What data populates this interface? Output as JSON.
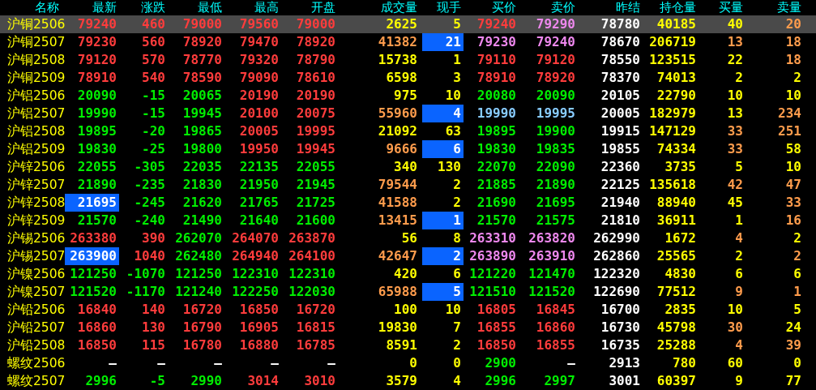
{
  "columns": [
    "名称",
    "最新",
    "涨跌",
    "最低",
    "最高",
    "开盘",
    "成交量",
    "现手",
    "买价",
    "卖价",
    "昨结",
    "持仓量",
    "买量",
    "卖量"
  ],
  "rows": [
    {
      "name": "沪铜2506",
      "selected": true,
      "cells": [
        {
          "text": "79240",
          "color": "#ff3c3c"
        },
        {
          "text": "460",
          "color": "#ff3c3c"
        },
        {
          "text": "79000",
          "color": "#ff3c3c"
        },
        {
          "text": "79560",
          "color": "#ff3c3c"
        },
        {
          "text": "79000",
          "color": "#ff3c3c"
        },
        {
          "text": "2625",
          "color": "#ffff00"
        },
        {
          "text": "5",
          "color": "#ffff00"
        },
        {
          "text": "79240",
          "color": "#ff3c3c"
        },
        {
          "text": "79290",
          "color": "#ee88ee"
        },
        {
          "text": "78780",
          "color": "#ffffff"
        },
        {
          "text": "40185",
          "color": "#ffff00"
        },
        {
          "text": "40",
          "color": "#ffff00"
        },
        {
          "text": "20",
          "color": "#ff9c4c"
        }
      ]
    },
    {
      "name": "沪铜2507",
      "selected": false,
      "cells": [
        {
          "text": "79230",
          "color": "#ff3c3c"
        },
        {
          "text": "560",
          "color": "#ff3c3c"
        },
        {
          "text": "78920",
          "color": "#ff3c3c"
        },
        {
          "text": "79470",
          "color": "#ff3c3c"
        },
        {
          "text": "78920",
          "color": "#ff3c3c"
        },
        {
          "text": "41382",
          "color": "#ff9c4c"
        },
        {
          "text": "21",
          "color": "#ffffff",
          "highlighted": true
        },
        {
          "text": "79230",
          "color": "#ee88ee"
        },
        {
          "text": "79240",
          "color": "#ee88ee"
        },
        {
          "text": "78670",
          "color": "#ffffff"
        },
        {
          "text": "206719",
          "color": "#ffff00"
        },
        {
          "text": "13",
          "color": "#ff9c4c"
        },
        {
          "text": "18",
          "color": "#ff9c4c"
        }
      ]
    },
    {
      "name": "沪铜2508",
      "selected": false,
      "cells": [
        {
          "text": "79120",
          "color": "#ff3c3c"
        },
        {
          "text": "570",
          "color": "#ff3c3c"
        },
        {
          "text": "78770",
          "color": "#ff3c3c"
        },
        {
          "text": "79320",
          "color": "#ff3c3c"
        },
        {
          "text": "78790",
          "color": "#ff3c3c"
        },
        {
          "text": "15738",
          "color": "#ffff00"
        },
        {
          "text": "1",
          "color": "#ffff00"
        },
        {
          "text": "79110",
          "color": "#ff3c3c"
        },
        {
          "text": "79120",
          "color": "#ff3c3c"
        },
        {
          "text": "78550",
          "color": "#ffffff"
        },
        {
          "text": "123515",
          "color": "#ffff00"
        },
        {
          "text": "22",
          "color": "#ffff00"
        },
        {
          "text": "18",
          "color": "#ff9c4c"
        }
      ]
    },
    {
      "name": "沪铜2509",
      "selected": false,
      "cells": [
        {
          "text": "78910",
          "color": "#ff3c3c"
        },
        {
          "text": "540",
          "color": "#ff3c3c"
        },
        {
          "text": "78590",
          "color": "#ff3c3c"
        },
        {
          "text": "79090",
          "color": "#ff3c3c"
        },
        {
          "text": "78610",
          "color": "#ff3c3c"
        },
        {
          "text": "6598",
          "color": "#ffff00"
        },
        {
          "text": "3",
          "color": "#ffff00"
        },
        {
          "text": "78910",
          "color": "#ff3c3c"
        },
        {
          "text": "78920",
          "color": "#ff3c3c"
        },
        {
          "text": "78370",
          "color": "#ffffff"
        },
        {
          "text": "74013",
          "color": "#ffff00"
        },
        {
          "text": "2",
          "color": "#ffff00"
        },
        {
          "text": "2",
          "color": "#ffff00"
        }
      ]
    },
    {
      "name": "沪铝2506",
      "selected": false,
      "cells": [
        {
          "text": "20090",
          "color": "#00ee00"
        },
        {
          "text": "-15",
          "color": "#00ee00"
        },
        {
          "text": "20065",
          "color": "#00ee00"
        },
        {
          "text": "20190",
          "color": "#ff3c3c"
        },
        {
          "text": "20190",
          "color": "#ff3c3c"
        },
        {
          "text": "975",
          "color": "#ffff00"
        },
        {
          "text": "10",
          "color": "#ffff00"
        },
        {
          "text": "20080",
          "color": "#00ee00"
        },
        {
          "text": "20090",
          "color": "#00ee00"
        },
        {
          "text": "20105",
          "color": "#ffffff"
        },
        {
          "text": "22790",
          "color": "#ffff00"
        },
        {
          "text": "10",
          "color": "#ffff00"
        },
        {
          "text": "10",
          "color": "#ffff00"
        }
      ]
    },
    {
      "name": "沪铝2507",
      "selected": false,
      "cells": [
        {
          "text": "19990",
          "color": "#00ee00"
        },
        {
          "text": "-15",
          "color": "#00ee00"
        },
        {
          "text": "19945",
          "color": "#00ee00"
        },
        {
          "text": "20100",
          "color": "#ff3c3c"
        },
        {
          "text": "20075",
          "color": "#ff3c3c"
        },
        {
          "text": "55960",
          "color": "#ff9c4c"
        },
        {
          "text": "4",
          "color": "#ffffff",
          "highlighted": true
        },
        {
          "text": "19990",
          "color": "#88ccff"
        },
        {
          "text": "19995",
          "color": "#88ccff"
        },
        {
          "text": "20005",
          "color": "#ffffff"
        },
        {
          "text": "182979",
          "color": "#ffff00"
        },
        {
          "text": "13",
          "color": "#ffff00"
        },
        {
          "text": "234",
          "color": "#ff9c4c"
        }
      ]
    },
    {
      "name": "沪铝2508",
      "selected": false,
      "cells": [
        {
          "text": "19895",
          "color": "#00ee00"
        },
        {
          "text": "-20",
          "color": "#00ee00"
        },
        {
          "text": "19865",
          "color": "#00ee00"
        },
        {
          "text": "20005",
          "color": "#ff3c3c"
        },
        {
          "text": "19995",
          "color": "#ff3c3c"
        },
        {
          "text": "21092",
          "color": "#ffff00"
        },
        {
          "text": "63",
          "color": "#ffff00"
        },
        {
          "text": "19895",
          "color": "#00ee00"
        },
        {
          "text": "19900",
          "color": "#00ee00"
        },
        {
          "text": "19915",
          "color": "#ffffff"
        },
        {
          "text": "147129",
          "color": "#ffff00"
        },
        {
          "text": "33",
          "color": "#ff9c4c"
        },
        {
          "text": "251",
          "color": "#ff9c4c"
        }
      ]
    },
    {
      "name": "沪铝2509",
      "selected": false,
      "cells": [
        {
          "text": "19830",
          "color": "#00ee00"
        },
        {
          "text": "-25",
          "color": "#00ee00"
        },
        {
          "text": "19800",
          "color": "#00ee00"
        },
        {
          "text": "19950",
          "color": "#ff3c3c"
        },
        {
          "text": "19945",
          "color": "#ff3c3c"
        },
        {
          "text": "9666",
          "color": "#ff9c4c"
        },
        {
          "text": "6",
          "color": "#ffffff",
          "highlighted": true
        },
        {
          "text": "19830",
          "color": "#00ee00"
        },
        {
          "text": "19835",
          "color": "#00ee00"
        },
        {
          "text": "19855",
          "color": "#ffffff"
        },
        {
          "text": "74334",
          "color": "#ffff00"
        },
        {
          "text": "33",
          "color": "#ff9c4c"
        },
        {
          "text": "58",
          "color": "#ffff00"
        }
      ]
    },
    {
      "name": "沪锌2506",
      "selected": false,
      "cells": [
        {
          "text": "22055",
          "color": "#00ee00"
        },
        {
          "text": "-305",
          "color": "#00ee00"
        },
        {
          "text": "22035",
          "color": "#00ee00"
        },
        {
          "text": "22135",
          "color": "#00ee00"
        },
        {
          "text": "22055",
          "color": "#00ee00"
        },
        {
          "text": "340",
          "color": "#ffff00"
        },
        {
          "text": "130",
          "color": "#ffff00"
        },
        {
          "text": "22070",
          "color": "#00ee00"
        },
        {
          "text": "22090",
          "color": "#00ee00"
        },
        {
          "text": "22360",
          "color": "#ffffff"
        },
        {
          "text": "3735",
          "color": "#ffff00"
        },
        {
          "text": "5",
          "color": "#ffff00"
        },
        {
          "text": "10",
          "color": "#ffff00"
        }
      ]
    },
    {
      "name": "沪锌2507",
      "selected": false,
      "cells": [
        {
          "text": "21890",
          "color": "#00ee00"
        },
        {
          "text": "-235",
          "color": "#00ee00"
        },
        {
          "text": "21830",
          "color": "#00ee00"
        },
        {
          "text": "21950",
          "color": "#00ee00"
        },
        {
          "text": "21945",
          "color": "#00ee00"
        },
        {
          "text": "79544",
          "color": "#ff9c4c"
        },
        {
          "text": "2",
          "color": "#ffff00"
        },
        {
          "text": "21885",
          "color": "#00ee00"
        },
        {
          "text": "21890",
          "color": "#00ee00"
        },
        {
          "text": "22125",
          "color": "#ffffff"
        },
        {
          "text": "135618",
          "color": "#ffff00"
        },
        {
          "text": "42",
          "color": "#ff9c4c"
        },
        {
          "text": "47",
          "color": "#ff9c4c"
        }
      ]
    },
    {
      "name": "沪锌2508",
      "selected": false,
      "cells": [
        {
          "text": "21695",
          "color": "#ffffff",
          "highlighted": true
        },
        {
          "text": "-245",
          "color": "#00ee00"
        },
        {
          "text": "21620",
          "color": "#00ee00"
        },
        {
          "text": "21765",
          "color": "#00ee00"
        },
        {
          "text": "21725",
          "color": "#00ee00"
        },
        {
          "text": "41588",
          "color": "#ff9c4c"
        },
        {
          "text": "2",
          "color": "#ffff00"
        },
        {
          "text": "21690",
          "color": "#00ee00"
        },
        {
          "text": "21695",
          "color": "#00ee00"
        },
        {
          "text": "21940",
          "color": "#ffffff"
        },
        {
          "text": "88940",
          "color": "#ffff00"
        },
        {
          "text": "45",
          "color": "#ffff00"
        },
        {
          "text": "33",
          "color": "#ff9c4c"
        }
      ]
    },
    {
      "name": "沪锌2509",
      "selected": false,
      "cells": [
        {
          "text": "21570",
          "color": "#00ee00"
        },
        {
          "text": "-240",
          "color": "#00ee00"
        },
        {
          "text": "21490",
          "color": "#00ee00"
        },
        {
          "text": "21640",
          "color": "#00ee00"
        },
        {
          "text": "21600",
          "color": "#00ee00"
        },
        {
          "text": "13415",
          "color": "#ff9c4c"
        },
        {
          "text": "1",
          "color": "#ffffff",
          "highlighted": true
        },
        {
          "text": "21570",
          "color": "#00ee00"
        },
        {
          "text": "21575",
          "color": "#00ee00"
        },
        {
          "text": "21810",
          "color": "#ffffff"
        },
        {
          "text": "36911",
          "color": "#ffff00"
        },
        {
          "text": "1",
          "color": "#ffff00"
        },
        {
          "text": "16",
          "color": "#ff9c4c"
        }
      ]
    },
    {
      "name": "沪锡2506",
      "selected": false,
      "cells": [
        {
          "text": "263380",
          "color": "#ff3c3c"
        },
        {
          "text": "390",
          "color": "#ff3c3c"
        },
        {
          "text": "262070",
          "color": "#00ee00"
        },
        {
          "text": "264070",
          "color": "#ff3c3c"
        },
        {
          "text": "263870",
          "color": "#ff3c3c"
        },
        {
          "text": "56",
          "color": "#ffff00"
        },
        {
          "text": "8",
          "color": "#ffff00"
        },
        {
          "text": "263310",
          "color": "#ee88ee"
        },
        {
          "text": "263820",
          "color": "#ee88ee"
        },
        {
          "text": "262990",
          "color": "#ffffff"
        },
        {
          "text": "1672",
          "color": "#ffff00"
        },
        {
          "text": "4",
          "color": "#ff9c4c"
        },
        {
          "text": "2",
          "color": "#ffff00"
        }
      ]
    },
    {
      "name": "沪锡2507",
      "selected": false,
      "cells": [
        {
          "text": "263900",
          "color": "#ffffff",
          "highlighted": true
        },
        {
          "text": "1040",
          "color": "#ff3c3c"
        },
        {
          "text": "262480",
          "color": "#00ee00"
        },
        {
          "text": "264940",
          "color": "#ff3c3c"
        },
        {
          "text": "264100",
          "color": "#ff3c3c"
        },
        {
          "text": "42647",
          "color": "#ff9c4c"
        },
        {
          "text": "2",
          "color": "#ffffff",
          "highlighted": true
        },
        {
          "text": "263890",
          "color": "#ee88ee"
        },
        {
          "text": "263910",
          "color": "#ee88ee"
        },
        {
          "text": "262860",
          "color": "#ffffff"
        },
        {
          "text": "25565",
          "color": "#ffff00"
        },
        {
          "text": "2",
          "color": "#ffff00"
        },
        {
          "text": "2",
          "color": "#ff9c4c"
        }
      ]
    },
    {
      "name": "沪镍2506",
      "selected": false,
      "cells": [
        {
          "text": "121250",
          "color": "#00ee00"
        },
        {
          "text": "-1070",
          "color": "#00ee00"
        },
        {
          "text": "121250",
          "color": "#00ee00"
        },
        {
          "text": "122310",
          "color": "#00ee00"
        },
        {
          "text": "122310",
          "color": "#00ee00"
        },
        {
          "text": "420",
          "color": "#ffff00"
        },
        {
          "text": "6",
          "color": "#ffff00"
        },
        {
          "text": "121220",
          "color": "#00ee00"
        },
        {
          "text": "121470",
          "color": "#00ee00"
        },
        {
          "text": "122320",
          "color": "#ffffff"
        },
        {
          "text": "4830",
          "color": "#ffff00"
        },
        {
          "text": "6",
          "color": "#ffff00"
        },
        {
          "text": "6",
          "color": "#ffff00"
        }
      ]
    },
    {
      "name": "沪镍2507",
      "selected": false,
      "cells": [
        {
          "text": "121520",
          "color": "#00ee00"
        },
        {
          "text": "-1170",
          "color": "#00ee00"
        },
        {
          "text": "121240",
          "color": "#00ee00"
        },
        {
          "text": "122250",
          "color": "#00ee00"
        },
        {
          "text": "122030",
          "color": "#00ee00"
        },
        {
          "text": "65988",
          "color": "#ff9c4c"
        },
        {
          "text": "5",
          "color": "#ffffff",
          "highlighted": true
        },
        {
          "text": "121510",
          "color": "#00ee00"
        },
        {
          "text": "121520",
          "color": "#00ee00"
        },
        {
          "text": "122690",
          "color": "#ffffff"
        },
        {
          "text": "77512",
          "color": "#ffff00"
        },
        {
          "text": "9",
          "color": "#ff9c4c"
        },
        {
          "text": "1",
          "color": "#ff9c4c"
        }
      ]
    },
    {
      "name": "沪铅2506",
      "selected": false,
      "cells": [
        {
          "text": "16840",
          "color": "#ff3c3c"
        },
        {
          "text": "140",
          "color": "#ff3c3c"
        },
        {
          "text": "16720",
          "color": "#ff3c3c"
        },
        {
          "text": "16850",
          "color": "#ff3c3c"
        },
        {
          "text": "16720",
          "color": "#ff3c3c"
        },
        {
          "text": "100",
          "color": "#ffff00"
        },
        {
          "text": "10",
          "color": "#ffff00"
        },
        {
          "text": "16805",
          "color": "#ff3c3c"
        },
        {
          "text": "16845",
          "color": "#ff3c3c"
        },
        {
          "text": "16700",
          "color": "#ffffff"
        },
        {
          "text": "2835",
          "color": "#ffff00"
        },
        {
          "text": "10",
          "color": "#ffff00"
        },
        {
          "text": "5",
          "color": "#ffff00"
        }
      ]
    },
    {
      "name": "沪铅2507",
      "selected": false,
      "cells": [
        {
          "text": "16860",
          "color": "#ff3c3c"
        },
        {
          "text": "130",
          "color": "#ff3c3c"
        },
        {
          "text": "16790",
          "color": "#ff3c3c"
        },
        {
          "text": "16905",
          "color": "#ff3c3c"
        },
        {
          "text": "16815",
          "color": "#ff3c3c"
        },
        {
          "text": "19830",
          "color": "#ffff00"
        },
        {
          "text": "7",
          "color": "#ffff00"
        },
        {
          "text": "16855",
          "color": "#ff3c3c"
        },
        {
          "text": "16860",
          "color": "#ff3c3c"
        },
        {
          "text": "16730",
          "color": "#ffffff"
        },
        {
          "text": "45798",
          "color": "#ffff00"
        },
        {
          "text": "30",
          "color": "#ff9c4c"
        },
        {
          "text": "24",
          "color": "#ffff00"
        }
      ]
    },
    {
      "name": "沪铅2508",
      "selected": false,
      "cells": [
        {
          "text": "16850",
          "color": "#ff3c3c"
        },
        {
          "text": "115",
          "color": "#ff3c3c"
        },
        {
          "text": "16780",
          "color": "#ff3c3c"
        },
        {
          "text": "16880",
          "color": "#ff3c3c"
        },
        {
          "text": "16785",
          "color": "#ff3c3c"
        },
        {
          "text": "8591",
          "color": "#ffff00"
        },
        {
          "text": "2",
          "color": "#ffff00"
        },
        {
          "text": "16850",
          "color": "#ff3c3c"
        },
        {
          "text": "16855",
          "color": "#ff3c3c"
        },
        {
          "text": "16735",
          "color": "#ffffff"
        },
        {
          "text": "25288",
          "color": "#ffff00"
        },
        {
          "text": "4",
          "color": "#ff9c4c"
        },
        {
          "text": "39",
          "color": "#ff9c4c"
        }
      ]
    },
    {
      "name": "螺纹2506",
      "selected": false,
      "cells": [
        {
          "text": "—",
          "color": "#ffffff"
        },
        {
          "text": "—",
          "color": "#ffffff"
        },
        {
          "text": "—",
          "color": "#ffffff"
        },
        {
          "text": "—",
          "color": "#ffffff"
        },
        {
          "text": "—",
          "color": "#ffffff"
        },
        {
          "text": "0",
          "color": "#ffff00"
        },
        {
          "text": "0",
          "color": "#ffff00"
        },
        {
          "text": "2900",
          "color": "#00ee00"
        },
        {
          "text": "—",
          "color": "#ffffff"
        },
        {
          "text": "2913",
          "color": "#ffffff"
        },
        {
          "text": "780",
          "color": "#ffff00"
        },
        {
          "text": "60",
          "color": "#ffff00"
        },
        {
          "text": "0",
          "color": "#ffff00"
        }
      ]
    },
    {
      "name": "螺纹2507",
      "selected": false,
      "cells": [
        {
          "text": "2996",
          "color": "#00ee00"
        },
        {
          "text": "-5",
          "color": "#00ee00"
        },
        {
          "text": "2990",
          "color": "#00ee00"
        },
        {
          "text": "3014",
          "color": "#ff3c3c"
        },
        {
          "text": "3010",
          "color": "#ff3c3c"
        },
        {
          "text": "3579",
          "color": "#ffff00"
        },
        {
          "text": "4",
          "color": "#ffff00"
        },
        {
          "text": "2996",
          "color": "#00ee00"
        },
        {
          "text": "2997",
          "color": "#00ee00"
        },
        {
          "text": "3001",
          "color": "#ffffff"
        },
        {
          "text": "60397",
          "color": "#ffff00"
        },
        {
          "text": "9",
          "color": "#ffff00"
        },
        {
          "text": "77",
          "color": "#ffff00"
        }
      ]
    }
  ]
}
